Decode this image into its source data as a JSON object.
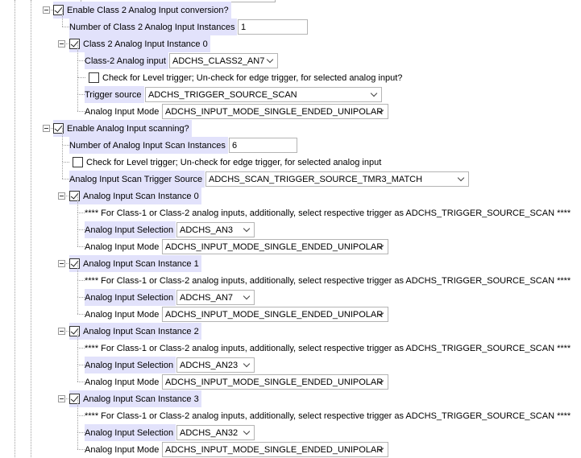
{
  "rows": [
    {
      "type": "check",
      "level": 1,
      "expander": true,
      "checked": true,
      "label": "Enable Class 2 Analog Input conversion?"
    },
    {
      "type": "field",
      "level": 2,
      "label": "Number of Class 2 Analog Input Instances",
      "value": "1"
    },
    {
      "type": "check",
      "level": 2,
      "expander": true,
      "checked": true,
      "label": "Class 2 Analog Input Instance 0"
    },
    {
      "type": "combo",
      "level": 3,
      "label": "Class-2 Analog input",
      "value": "ADCHS_CLASS2_AN7"
    },
    {
      "type": "check",
      "level": 3,
      "checked": false,
      "plain": true,
      "label": "Check for Level trigger; Un-check for edge trigger, for selected analog input?"
    },
    {
      "type": "combo",
      "level": 3,
      "label": "Trigger source",
      "value": "ADCHS_TRIGGER_SOURCE_SCAN"
    },
    {
      "type": "combo",
      "level": 3,
      "label": "Analog Input Mode",
      "value": "ADCHS_INPUT_MODE_SINGLE_ENDED_UNIPOLAR",
      "plainLabel": true
    },
    {
      "type": "check",
      "level": 1,
      "expander": true,
      "checked": true,
      "label": "Enable Analog Input scanning?"
    },
    {
      "type": "field",
      "level": 2,
      "label": "Number of Analog Input Scan Instances",
      "value": "6"
    },
    {
      "type": "check",
      "level": 2,
      "checked": false,
      "plain": true,
      "label": "Check for Level trigger; Un-check for edge trigger, for selected analog input"
    },
    {
      "type": "combo",
      "level": 2,
      "label": "Analog Input Scan Trigger Source",
      "value": "ADCHS_SCAN_TRIGGER_SOURCE_TMR3_MATCH"
    },
    {
      "type": "check",
      "level": 2,
      "expander": true,
      "checked": true,
      "label": "Analog Input Scan Instance 0"
    },
    {
      "type": "note",
      "level": 3,
      "label": "**** For Class-1 or Class-2 analog inputs, additionally, select respective trigger as ADCHS_TRIGGER_SOURCE_SCAN ****"
    },
    {
      "type": "combo",
      "level": 3,
      "label": "Analog Input Selection",
      "value": "ADCHS_AN3"
    },
    {
      "type": "combo",
      "level": 3,
      "label": "Analog Input Mode",
      "value": "ADCHS_INPUT_MODE_SINGLE_ENDED_UNIPOLAR",
      "plainLabel": true
    },
    {
      "type": "check",
      "level": 2,
      "expander": true,
      "checked": true,
      "label": "Analog Input Scan Instance 1"
    },
    {
      "type": "note",
      "level": 3,
      "label": "**** For Class-1 or Class-2 analog inputs, additionally, select respective trigger as ADCHS_TRIGGER_SOURCE_SCAN ****"
    },
    {
      "type": "combo",
      "level": 3,
      "label": "Analog Input Selection",
      "value": "ADCHS_AN7"
    },
    {
      "type": "combo",
      "level": 3,
      "label": "Analog Input Mode",
      "value": "ADCHS_INPUT_MODE_SINGLE_ENDED_UNIPOLAR",
      "plainLabel": true
    },
    {
      "type": "check",
      "level": 2,
      "expander": true,
      "checked": true,
      "label": "Analog Input Scan Instance 2"
    },
    {
      "type": "note",
      "level": 3,
      "label": "**** For Class-1 or Class-2 analog inputs, additionally, select respective trigger as ADCHS_TRIGGER_SOURCE_SCAN ****"
    },
    {
      "type": "combo",
      "level": 3,
      "label": "Analog Input Selection",
      "value": "ADCHS_AN23"
    },
    {
      "type": "combo",
      "level": 3,
      "label": "Analog Input Mode",
      "value": "ADCHS_INPUT_MODE_SINGLE_ENDED_UNIPOLAR",
      "plainLabel": true
    },
    {
      "type": "check",
      "level": 2,
      "expander": true,
      "checked": true,
      "label": "Analog Input Scan Instance 3"
    },
    {
      "type": "note",
      "level": 3,
      "label": "**** For Class-1 or Class-2 analog inputs, additionally, select respective trigger as ADCHS_TRIGGER_SOURCE_SCAN ****"
    },
    {
      "type": "combo",
      "level": 3,
      "label": "Analog Input Selection",
      "value": "ADCHS_AN32"
    },
    {
      "type": "combo",
      "level": 3,
      "label": "Analog Input Mode",
      "value": "ADCHS_INPUT_MODE_SINGLE_ENDED_UNIPOLAR",
      "plainLabel": true
    }
  ]
}
